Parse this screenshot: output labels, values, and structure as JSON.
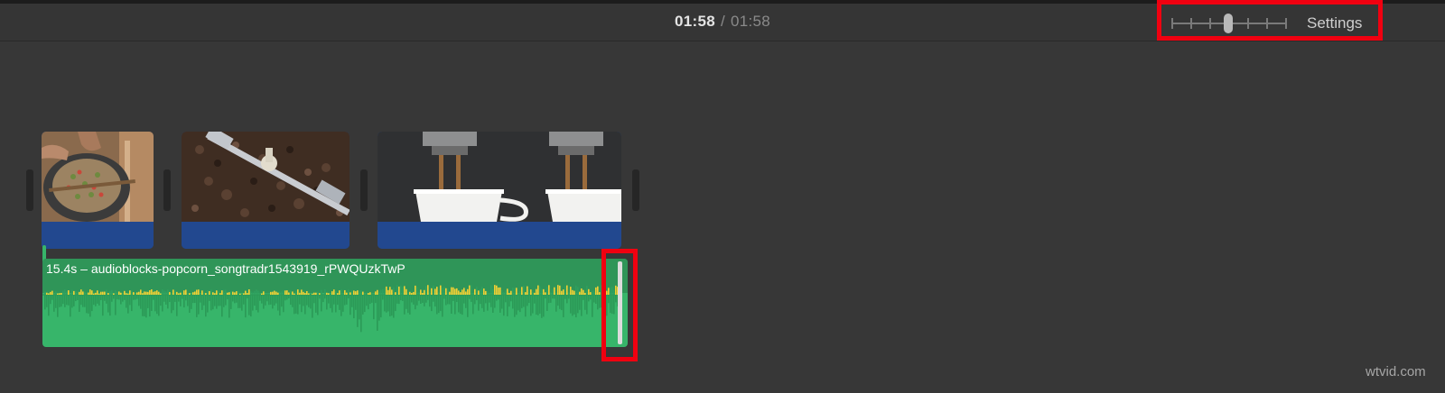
{
  "timecode": {
    "current": "01:58",
    "separator": "/",
    "total": "01:58"
  },
  "toolbar": {
    "zoom_slider_icon": "zoom-slider-icon",
    "zoom_level": 0.5,
    "settings_label": "Settings"
  },
  "video_clips": [
    {
      "name": "clip-coffee-beans-sorting",
      "thumbnail": "hands sorting coffee cherries in a sieve"
    },
    {
      "name": "clip-coffee-roasting",
      "thumbnail": "coffee beans in a roaster drum"
    },
    {
      "name": "clip-espresso-pouring",
      "thumbnail": "espresso pouring into two white cups"
    }
  ],
  "audio_clip": {
    "title": "15.4s – audioblocks-popcorn_songtradr1543919_rPWQUzkTwP"
  },
  "watermark": "wtvid.com",
  "colors": {
    "background": "#373737",
    "video_clip_bar": "#22488f",
    "audio_clip": "#37b56a",
    "audio_header": "#2f9558",
    "audio_peak": "#f2cf33",
    "highlight": "#f00010"
  }
}
